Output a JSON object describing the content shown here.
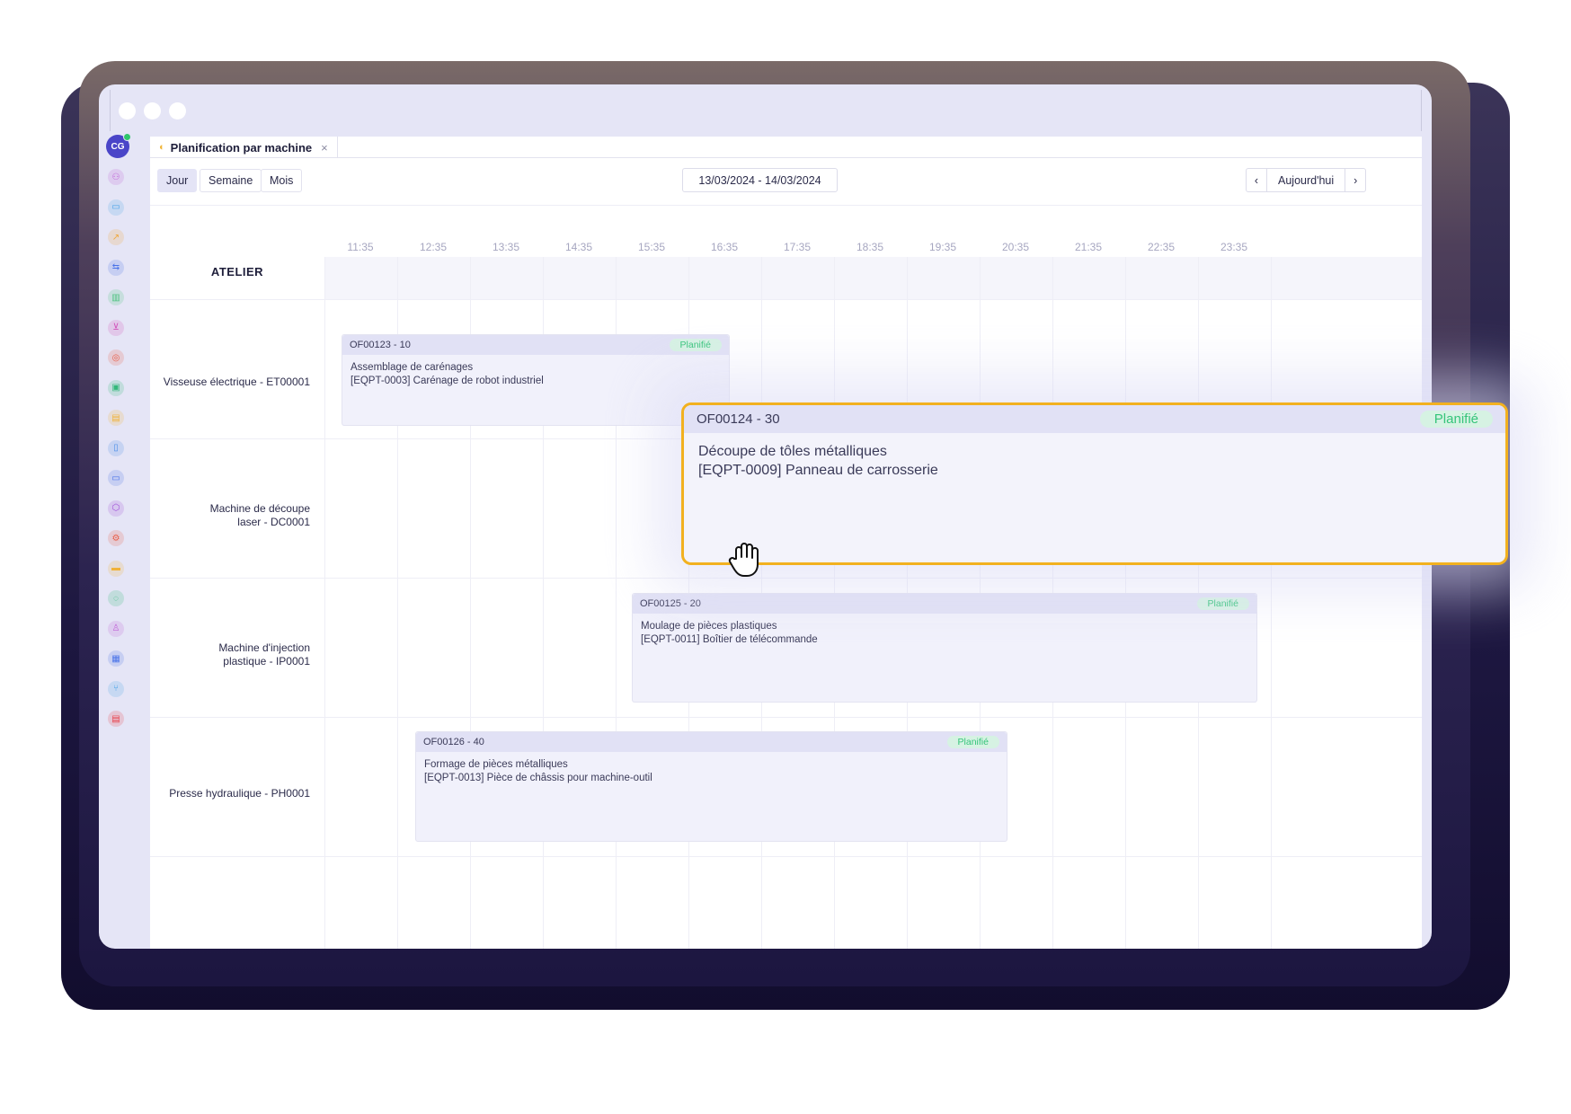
{
  "window": {
    "controls": [
      "close",
      "minimize",
      "maximize"
    ]
  },
  "user": {
    "initials": "CG"
  },
  "sidebar_icons": [
    {
      "name": "users-icon",
      "color": "#c065d8"
    },
    {
      "name": "card-icon",
      "color": "#4aa3e8"
    },
    {
      "name": "trend-icon",
      "color": "#f0a73a"
    },
    {
      "name": "transfer-icon",
      "color": "#4a73e8"
    },
    {
      "name": "chart-icon",
      "color": "#4cc27f"
    },
    {
      "name": "cart-icon",
      "color": "#d04fb8"
    },
    {
      "name": "tag-icon",
      "color": "#e8604a"
    },
    {
      "name": "briefcase-icon",
      "color": "#33b87a"
    },
    {
      "name": "document-icon",
      "color": "#f0b23a"
    },
    {
      "name": "file-icon",
      "color": "#4a8ee8"
    },
    {
      "name": "monitor-icon",
      "color": "#4a73e8"
    },
    {
      "name": "box-icon",
      "color": "#a04fd8"
    },
    {
      "name": "gear-icon",
      "color": "#e8604a"
    },
    {
      "name": "printer-icon",
      "color": "#f0b23a"
    },
    {
      "name": "chat-icon",
      "color": "#33b87a"
    },
    {
      "name": "person-icon",
      "color": "#c065d8"
    },
    {
      "name": "building-icon",
      "color": "#4a73e8"
    },
    {
      "name": "fork-icon",
      "color": "#4aa3e8"
    },
    {
      "name": "inbox-icon",
      "color": "#e8404a"
    }
  ],
  "tab": {
    "label": "Planification par machine",
    "close": "×"
  },
  "views": {
    "day": "Jour",
    "week": "Semaine",
    "month": "Mois",
    "active": "day"
  },
  "date_range": "13/03/2024 - 14/03/2024",
  "nav": {
    "prev": "‹",
    "today": "Aujourd'hui",
    "next": "›"
  },
  "timeline": {
    "hours": [
      "11:35",
      "12:35",
      "13:35",
      "14:35",
      "15:35",
      "16:35",
      "17:35",
      "18:35",
      "19:35",
      "20:35",
      "21:35",
      "22:35",
      "23:35"
    ]
  },
  "workshop": "ATELIER",
  "machines": [
    {
      "line1": "Visseuse électrique - ET00001",
      "line2": ""
    },
    {
      "line1": "Machine de découpe",
      "line2": "laser - DC0001"
    },
    {
      "line1": "Machine d'injection",
      "line2": "plastique - IP0001"
    },
    {
      "line1": "Presse hydraulique - PH0001",
      "line2": ""
    }
  ],
  "orders": [
    {
      "code": "OF00123 - 10",
      "status": "Planifié",
      "operation": "Assemblage de carénages",
      "item": "[EQPT-0003] Carénage de robot industriel"
    },
    {
      "code": "OF00124 - 30",
      "status": "Planifié",
      "operation": "Découpe de tôles métalliques",
      "item": "[EQPT-0009] Panneau de carrosserie"
    },
    {
      "code": "OF00125 - 20",
      "status": "Planifié",
      "operation": "Moulage de pièces plastiques",
      "item": "[EQPT-0011] Boîtier de télécommande"
    },
    {
      "code": "OF00126 - 40",
      "status": "Planifié",
      "operation": "Formage de pièces métalliques",
      "item": "[EQPT-0013] Pièce de châssis pour machine-outil"
    }
  ],
  "colors": {
    "accent": "#4a45c8",
    "drag_highlight": "#f2b11f",
    "status_planned": "#35c47a"
  }
}
